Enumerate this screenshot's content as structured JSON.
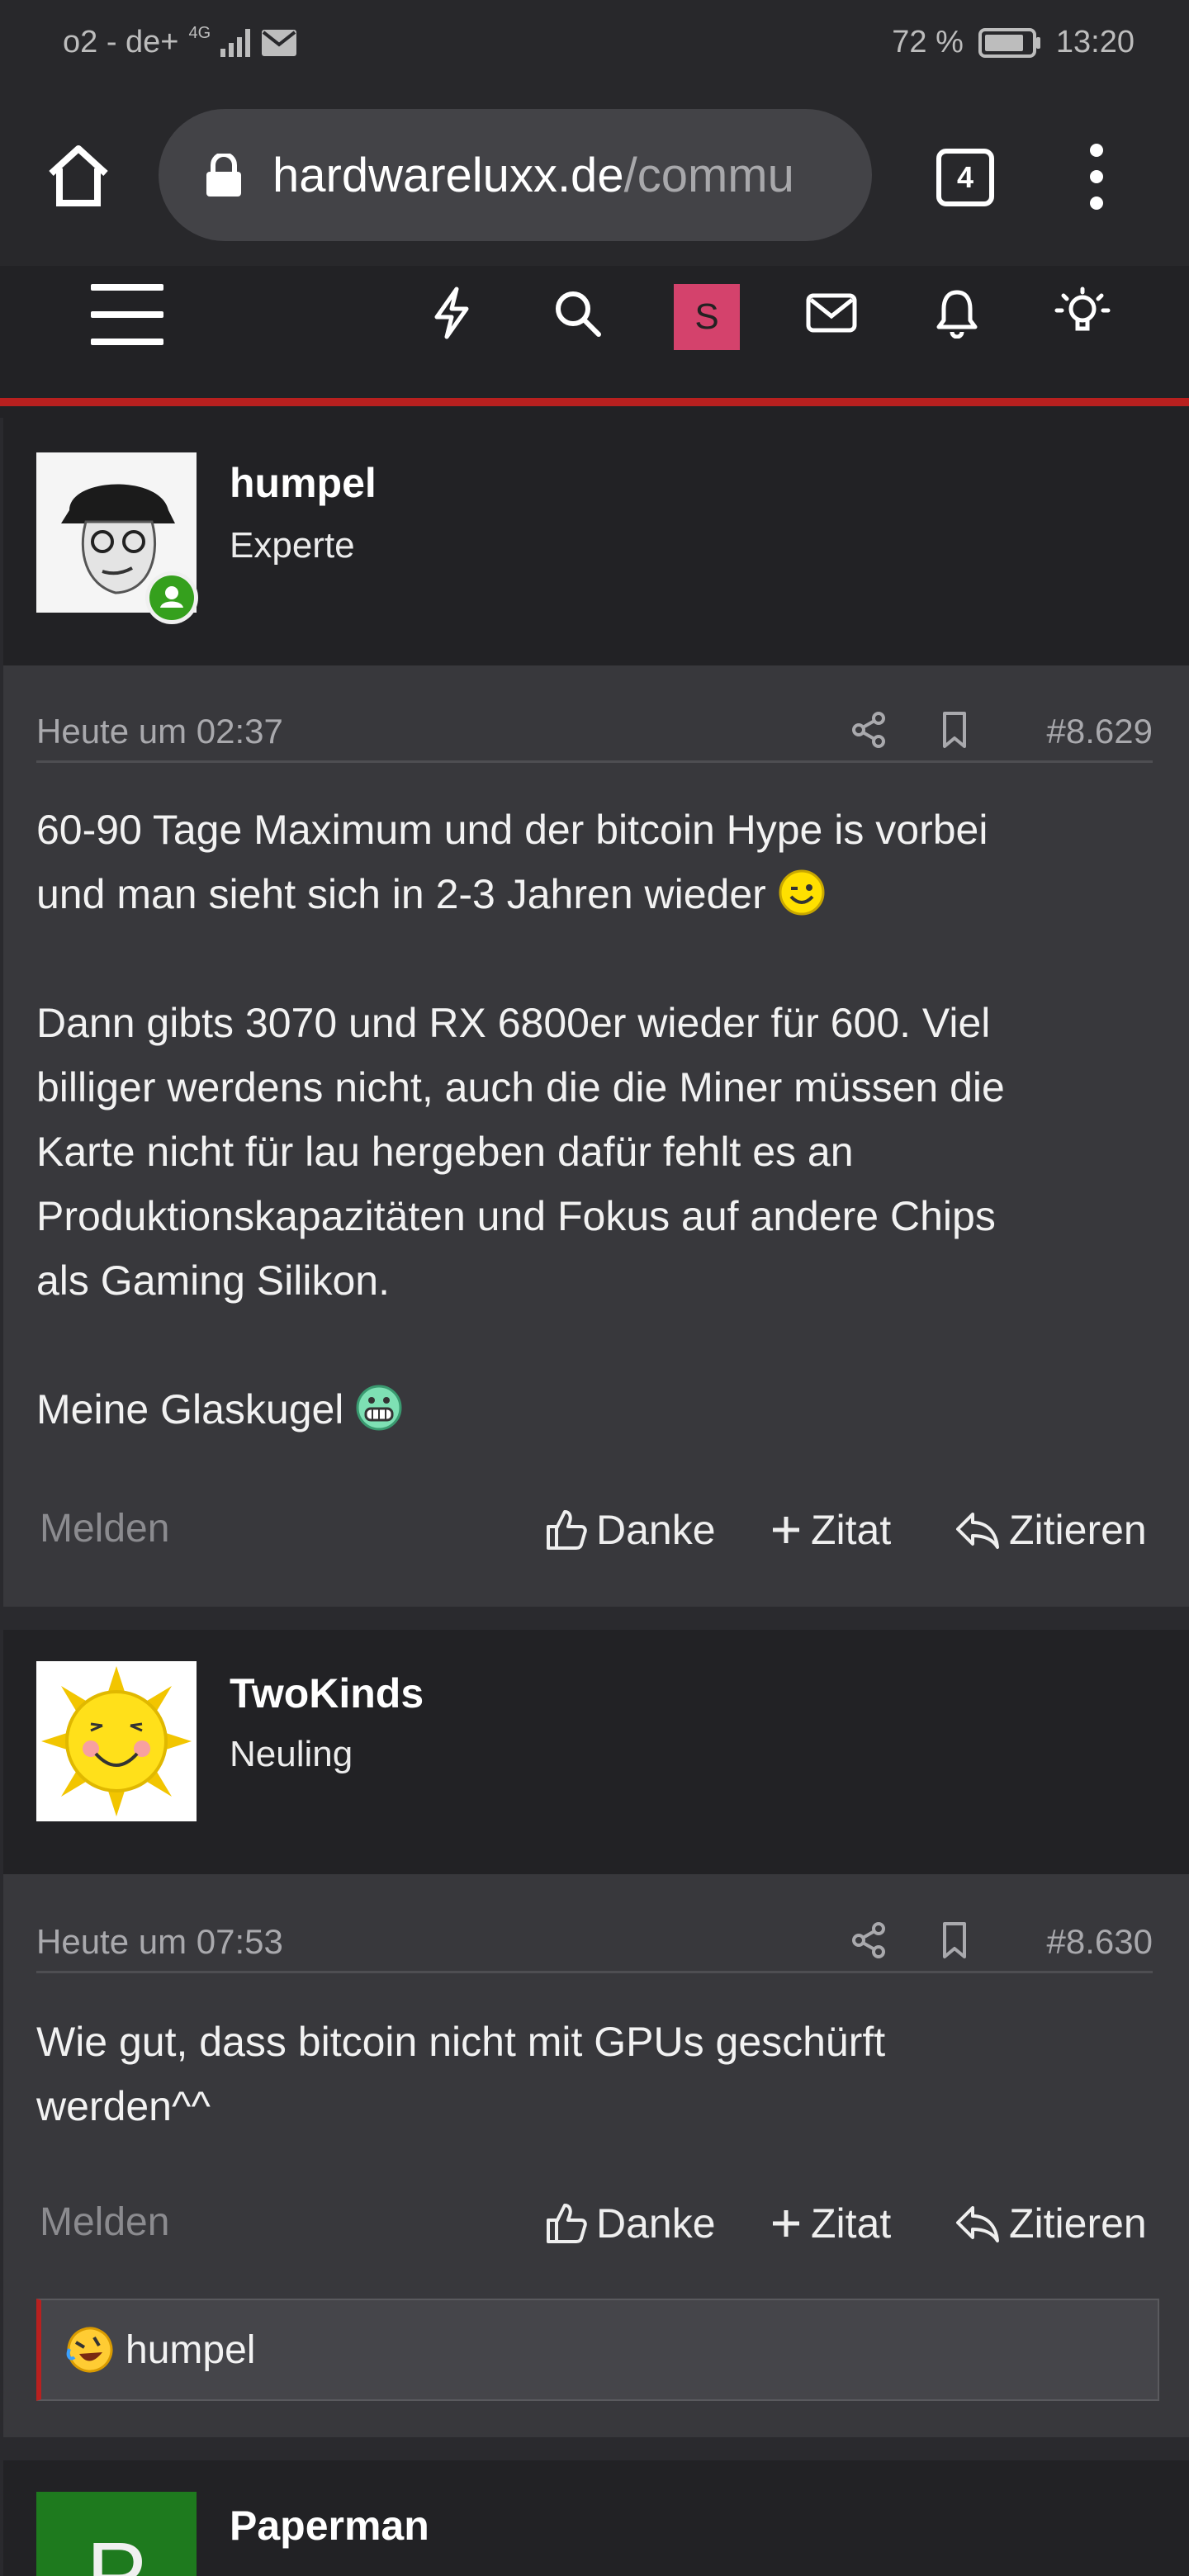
{
  "status_bar": {
    "carrier": "o2 - de+",
    "network": "4G",
    "battery_percent": "72 %",
    "time": "13:20"
  },
  "browser": {
    "url_host": "hardwareluxx.de",
    "url_path": "/commu",
    "tab_count": "4"
  },
  "site_nav": {
    "user_initial": "S",
    "icons": [
      "menu-icon",
      "bolt-icon",
      "search-icon",
      "envelope-icon",
      "bell-icon",
      "lightbulb-icon"
    ]
  },
  "posts": [
    {
      "username": "humpel",
      "user_title": "Experte",
      "date": "Heute um 02:37",
      "post_number": "#8.629",
      "message": [
        "60-90 Tage Maximum und der bitcoin Hype is vorbei",
        "und man sieht sich in 2-3 Jahren wieder",
        "",
        "Dann gibts 3070 und RX 6800er wieder für 600. Viel",
        "billiger werdens nicht, auch die die Miner müssen die",
        "Karte nicht für lau hergeben dafür fehlt es an",
        "Produktionskapazitäten und Fokus auf andere Chips",
        "als Gaming Silikon.",
        "",
        "Meine Glaskugel"
      ],
      "report": "Melden",
      "like": "Danke",
      "multiquote": "Zitat",
      "reply": "Zitieren"
    },
    {
      "username": "TwoKinds",
      "user_title": "Neuling",
      "date": "Heute um 07:53",
      "post_number": "#8.630",
      "message": [
        "Wie gut, dass bitcoin nicht mit GPUs geschürft",
        "werden^^"
      ],
      "report": "Melden",
      "like": "Danke",
      "multiquote": "Zitat",
      "reply": "Zitieren",
      "reaction_user": "humpel"
    },
    {
      "username": "Paperman",
      "avatar_letter": "P"
    }
  ],
  "colors": {
    "accent_red": "#b8201f",
    "header_bg": "#222225",
    "body_bg": "#38383c",
    "user_badge": "#d4426c",
    "avatar_green": "#1e7a1e"
  }
}
